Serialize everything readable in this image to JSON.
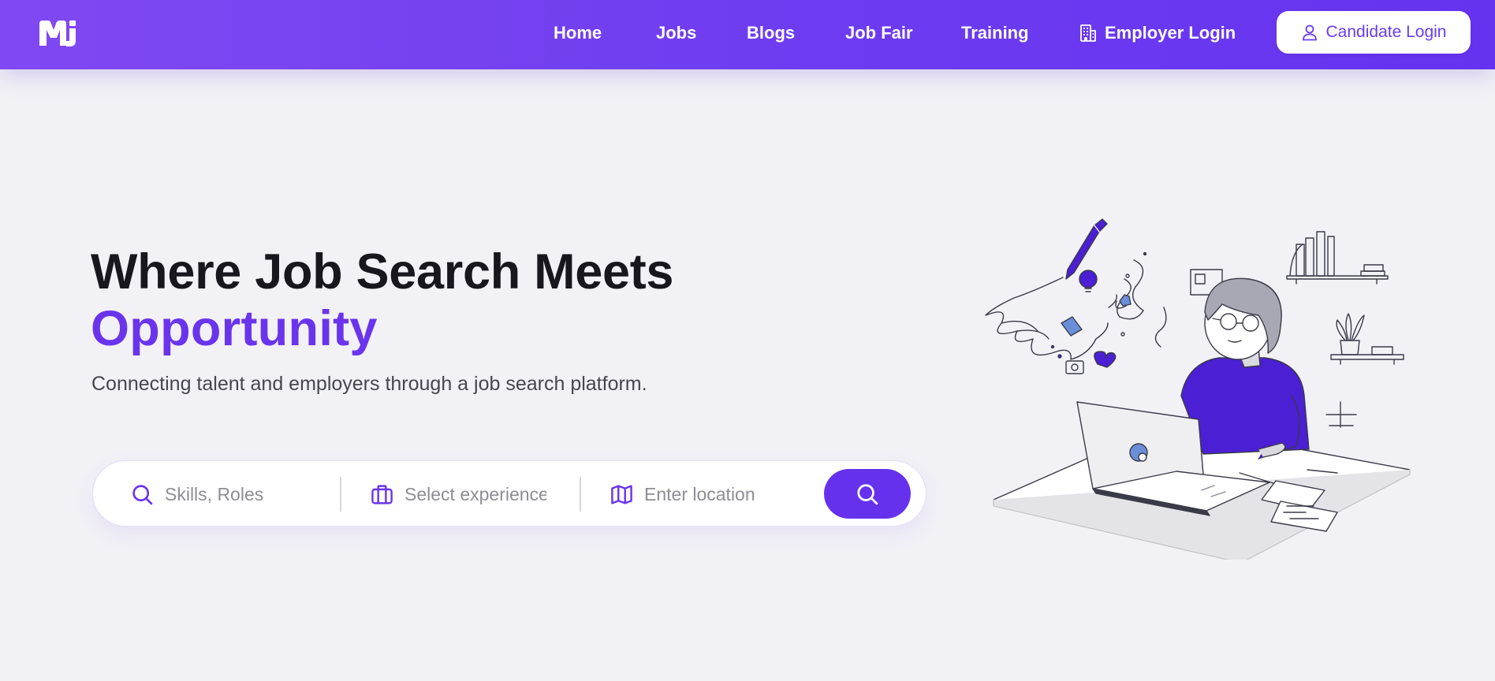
{
  "brand": {
    "logo_text": "MJ"
  },
  "nav": {
    "items": [
      {
        "label": "Home"
      },
      {
        "label": "Jobs"
      },
      {
        "label": "Blogs"
      },
      {
        "label": "Job Fair"
      },
      {
        "label": "Training"
      }
    ],
    "employer_login": "Employer Login",
    "candidate_login": "Candidate Login"
  },
  "hero": {
    "title_line1": "Where Job Search Meets",
    "title_line2": "Opportunity",
    "subtitle": "Connecting talent and employers through a job search platform."
  },
  "search": {
    "skills_placeholder": "Skills, Roles",
    "experience_placeholder": "Select experience",
    "location_placeholder": "Enter location"
  },
  "icons": {
    "employer": "building-icon",
    "candidate": "user-icon",
    "skills": "search-icon",
    "experience": "briefcase-icon",
    "location": "map-icon",
    "submit": "search-icon"
  },
  "colors": {
    "primary": "#6a34ec",
    "nav_gradient_start": "#8048f2",
    "nav_gradient_end": "#6533ef",
    "background": "#f2f1f6",
    "heading": "#17171d"
  }
}
